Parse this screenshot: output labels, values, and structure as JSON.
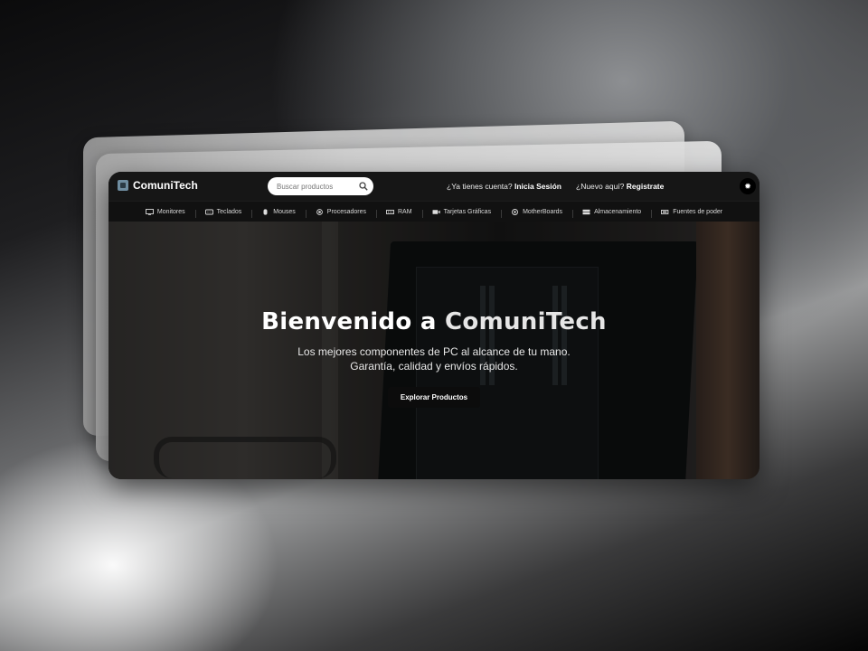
{
  "brand": {
    "name": "ComuniTech"
  },
  "search": {
    "placeholder": "Buscar productos"
  },
  "auth": {
    "login_prompt": "¿Ya tienes cuenta?",
    "login_link": "Inicia Sesión",
    "register_prompt": "¿Nuevo aquí?",
    "register_link": "Registrate"
  },
  "nav": {
    "items": [
      {
        "label": "Monitores",
        "icon": "monitor-icon"
      },
      {
        "label": "Teclados",
        "icon": "keyboard-icon"
      },
      {
        "label": "Mouses",
        "icon": "mouse-icon"
      },
      {
        "label": "Procesadores",
        "icon": "cpu-icon"
      },
      {
        "label": "RAM",
        "icon": "ram-icon"
      },
      {
        "label": "Tarjetas Gráficas",
        "icon": "gpu-icon"
      },
      {
        "label": "MotherBoards",
        "icon": "motherboard-icon"
      },
      {
        "label": "Almacenamiento",
        "icon": "storage-icon"
      },
      {
        "label": "Fuentes de poder",
        "icon": "power-supply-icon"
      }
    ]
  },
  "hero": {
    "title_prefix": "Bienvenido a ",
    "title_brand": "ComuniTech",
    "subtitle_line1": "Los mejores componentes de PC al alcance de tu mano.",
    "subtitle_line2": "Garantía, calidad y envíos rápidos.",
    "cta_label": "Explorar Productos"
  },
  "colors": {
    "topbar": "#161616",
    "navbar": "#111111",
    "cta_bg": "#0c0c0c",
    "logo": "#6f8da0"
  }
}
